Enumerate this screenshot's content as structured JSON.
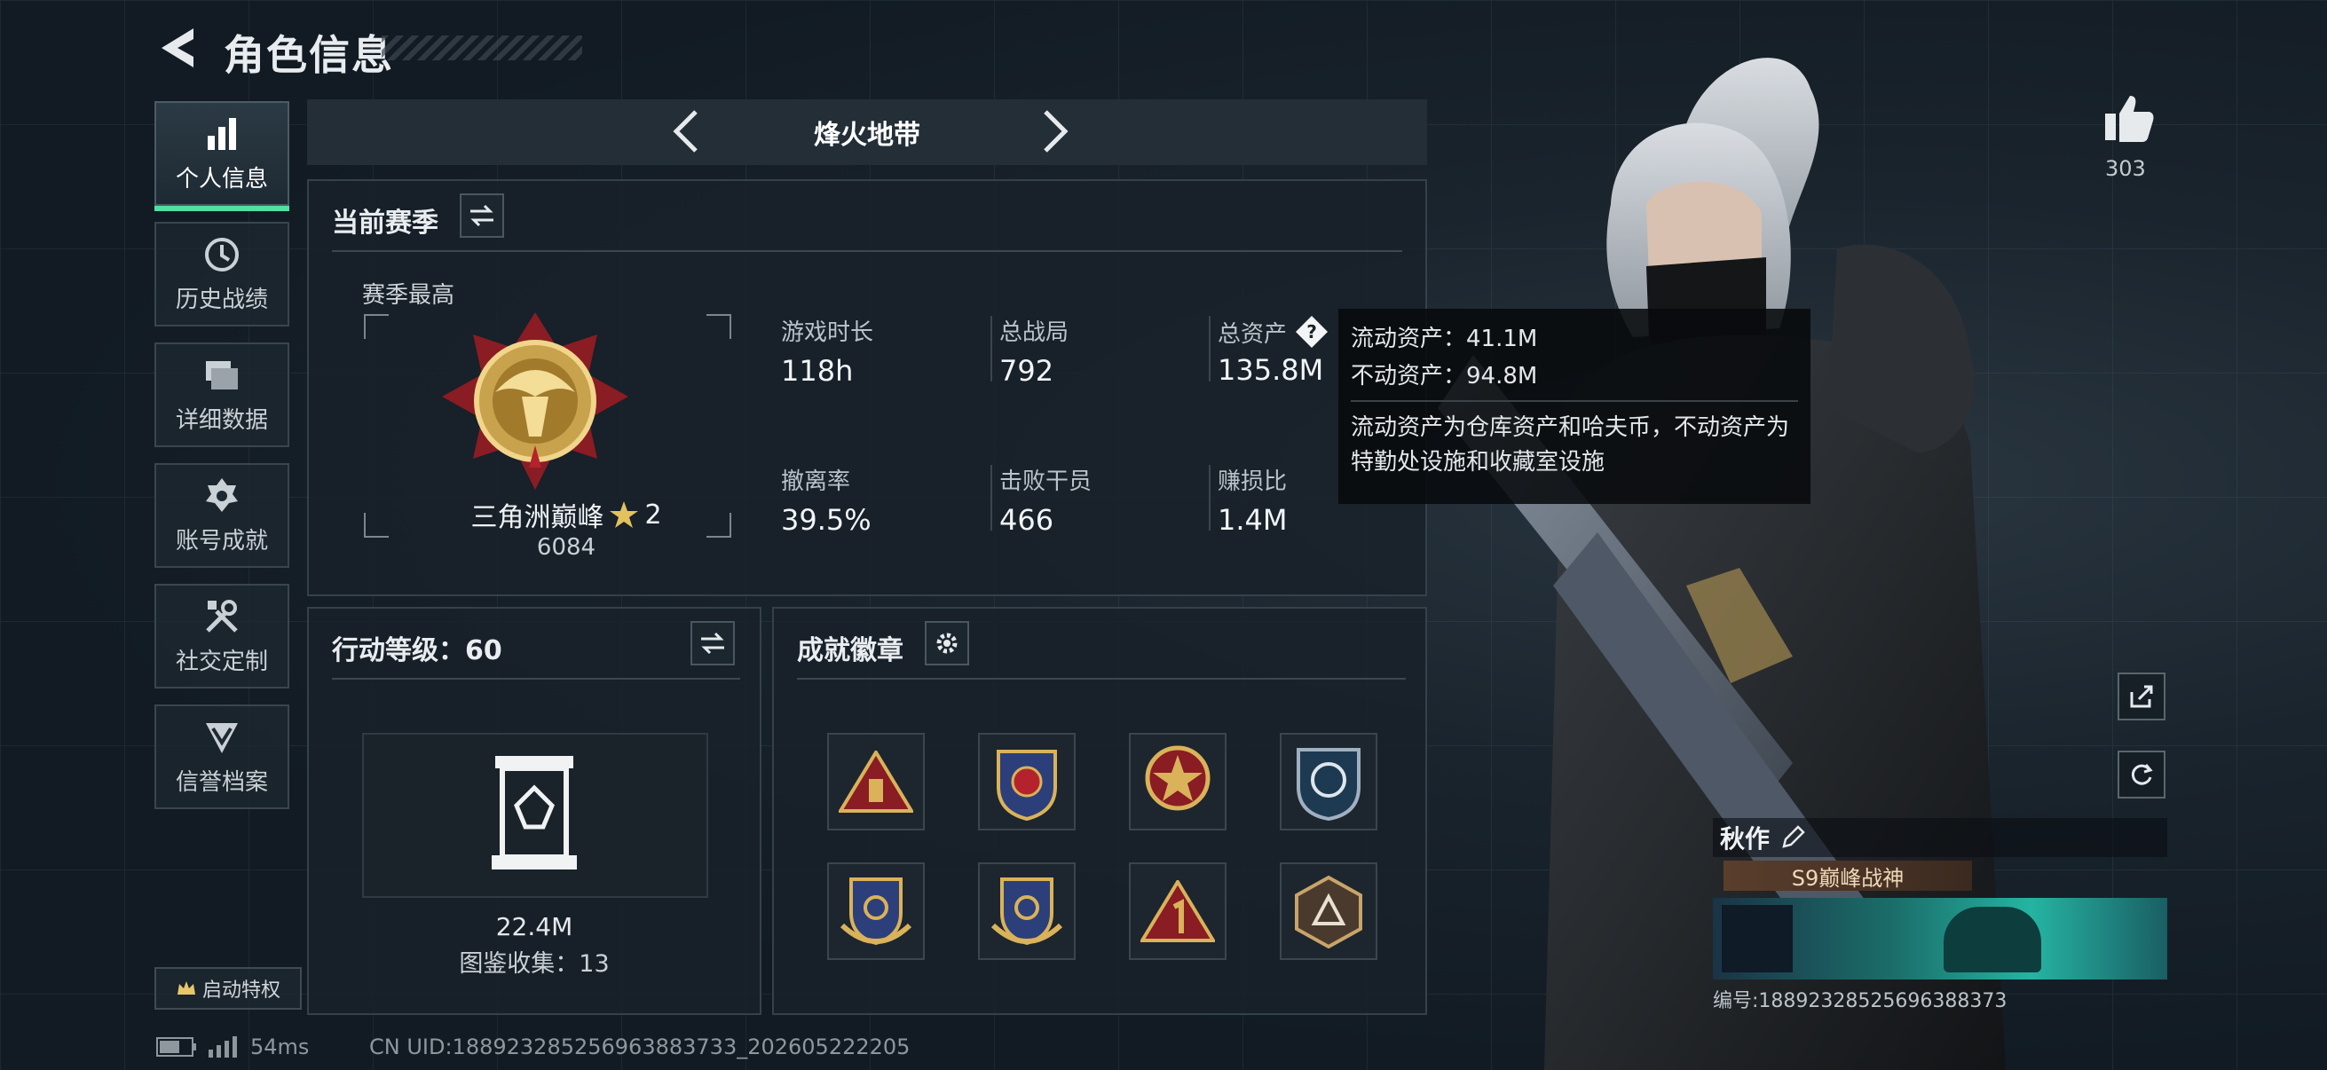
{
  "header": {
    "title": "角色信息"
  },
  "sidebar": {
    "items": [
      {
        "label": "个人信息",
        "icon": "bar-chart-icon",
        "active": true
      },
      {
        "label": "历史战绩",
        "icon": "clock-icon"
      },
      {
        "label": "详细数据",
        "icon": "stack-icon"
      },
      {
        "label": "账号成就",
        "icon": "medal-icon"
      },
      {
        "label": "社交定制",
        "icon": "tools-icon"
      },
      {
        "label": "信誉档案",
        "icon": "shield-chevron-icon"
      }
    ],
    "privilege_button": "启动特权"
  },
  "mode": {
    "title": "烽火地带"
  },
  "season": {
    "title": "当前赛季",
    "best_label": "赛季最高",
    "rank_name": "三角洲巅峰",
    "rank_stars": "2",
    "rank_score": "6084",
    "stats": [
      {
        "label": "游戏时长",
        "value": "118h"
      },
      {
        "label": "总战局",
        "value": "792"
      },
      {
        "label": "总资产",
        "value": "135.8M"
      },
      {
        "label": "撤离率",
        "value": "39.5%"
      },
      {
        "label": "击败干员",
        "value": "466"
      },
      {
        "label": "赚损比",
        "value": "1.4M"
      }
    ]
  },
  "tooltip": {
    "liquid": "流动资产：41.1M",
    "fixed": "不动资产：94.8M",
    "desc": "流动资产为仓库资产和哈夫币，不动资产为特勤处设施和收藏室设施"
  },
  "level": {
    "title": "行动等级：60",
    "value": "22.4M",
    "collection": "图鉴收集：13"
  },
  "badges": {
    "title": "成就徽章",
    "items": [
      "badge-1",
      "badge-2",
      "badge-3",
      "badge-4",
      "badge-5",
      "badge-6",
      "badge-7",
      "badge-8"
    ]
  },
  "likes": {
    "count": "303"
  },
  "profile_card": {
    "name": "秋作",
    "rank_title": "S9巅峰战神",
    "id_text": "编号:18892328525696388373"
  },
  "footer": {
    "ping": "54ms",
    "uid": "CN UID:18892328525696388373​3_202605222205"
  },
  "colors": {
    "accent": "#4fe0a2",
    "gold": "#d9b25a"
  }
}
